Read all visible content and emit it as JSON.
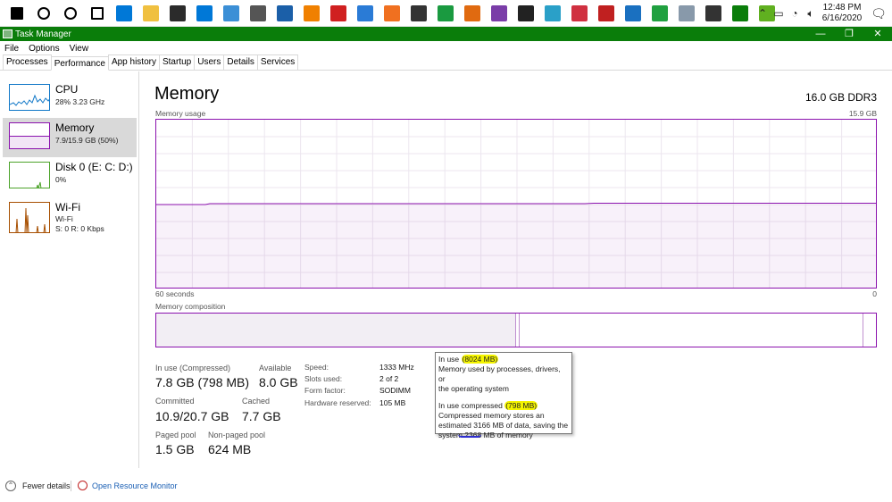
{
  "taskbar": {
    "icons": [
      {
        "name": "windows-start-icon",
        "color": "#000000"
      },
      {
        "name": "search-icon",
        "color": "#000000"
      },
      {
        "name": "cortana-icon",
        "color": "#000000"
      },
      {
        "name": "task-view-icon",
        "color": "#000000"
      },
      {
        "name": "edge-icon",
        "color": "#0078d7"
      },
      {
        "name": "file-explorer-icon",
        "color": "#f0c040"
      },
      {
        "name": "store-icon",
        "color": "#2b2b2b"
      },
      {
        "name": "mail-icon",
        "color": "#0078d7"
      },
      {
        "name": "remote-desktop-icon",
        "color": "#3b8fd6"
      },
      {
        "name": "settings-icon",
        "color": "#555555"
      },
      {
        "name": "photos-icon",
        "color": "#1b5fa8"
      },
      {
        "name": "vlc-icon",
        "color": "#f08000"
      },
      {
        "name": "record-icon",
        "color": "#d02020"
      },
      {
        "name": "vscode-icon",
        "color": "#2a7bd6"
      },
      {
        "name": "media-icon",
        "color": "#f07020"
      },
      {
        "name": "7zip-icon",
        "color": "#333333"
      },
      {
        "name": "browser-icon",
        "color": "#1a9a40"
      },
      {
        "name": "firefox-icon",
        "color": "#e06a10"
      },
      {
        "name": "app-purple-icon",
        "color": "#7a3da8"
      },
      {
        "name": "app-dark-icon",
        "color": "#222222"
      },
      {
        "name": "app-cyan-icon",
        "color": "#2aa0c8"
      },
      {
        "name": "snipping-icon",
        "color": "#d03040"
      },
      {
        "name": "calculator-grid-icon",
        "color": "#c02020"
      },
      {
        "name": "app-blue-icon",
        "color": "#1a70c0"
      },
      {
        "name": "app-green-icon",
        "color": "#20a040"
      },
      {
        "name": "app-grey-icon",
        "color": "#8899aa"
      },
      {
        "name": "calculator-icon",
        "color": "#333333"
      },
      {
        "name": "task-manager-icon",
        "color": "#0a7d0a"
      },
      {
        "name": "app-lime-icon",
        "color": "#60b020"
      }
    ],
    "time": "12:48 PM",
    "date": "6/16/2020"
  },
  "window": {
    "title": "Task Manager",
    "minimize": "—",
    "maximize": "❐",
    "close": "✕"
  },
  "menu": [
    "File",
    "Options",
    "View"
  ],
  "tabs": [
    "Processes",
    "Performance",
    "App history",
    "Startup",
    "Users",
    "Details",
    "Services"
  ],
  "sidebar": {
    "cpu": {
      "title": "CPU",
      "sub1": "28%  3.23 GHz",
      "color": "#1178c8"
    },
    "memory": {
      "title": "Memory",
      "sub1": "7.9/15.9 GB (50%)",
      "color": "#8b12ae"
    },
    "disk": {
      "title": "Disk 0 (E: C: D:)",
      "sub1": "0%",
      "color": "#4ca32a"
    },
    "wifi": {
      "title": "Wi-Fi",
      "sub1": "Wi-Fi",
      "sub2": "S: 0  R: 0 Kbps",
      "color": "#a74f01"
    }
  },
  "main": {
    "title": "Memory",
    "total": "16.0 GB DDR3",
    "usage_label": "Memory usage",
    "usage_max": "15.9 GB",
    "time_left": "60 seconds",
    "time_right": "0",
    "composition_label": "Memory composition",
    "in_use_fraction": 0.5
  },
  "stats": {
    "in_use_label": "In use (Compressed)",
    "in_use_value": "7.8 GB (798 MB)",
    "available_label": "Available",
    "available_value": "8.0 GB",
    "committed_label": "Committed",
    "committed_value": "10.9/20.7 GB",
    "cached_label": "Cached",
    "cached_value": "7.7 GB",
    "paged_label": "Paged pool",
    "paged_value": "1.5 GB",
    "nonpaged_label": "Non-paged pool",
    "nonpaged_value": "624 MB"
  },
  "props": {
    "speed_label": "Speed:",
    "speed_value": "1333 MHz",
    "slots_label": "Slots used:",
    "slots_value": "2 of 2",
    "form_label": "Form factor:",
    "form_value": "SODIMM",
    "hw_label": "Hardware reserved:",
    "hw_value": "105 MB"
  },
  "tooltip": {
    "l1a": "In use ",
    "l1b": "(8024 MB)",
    "l2": "Memory used by processes, drivers, or",
    "l3": "the operating system",
    "l4a": "In use compressed ",
    "l4b": "(798 MB)",
    "l5": "Compressed memory stores an",
    "l6": "estimated 3166 MB of data, saving the",
    "l7": "system 2368 MB of memory"
  },
  "footer": {
    "fewer": "Fewer details",
    "monitor": "Open Resource Monitor"
  }
}
